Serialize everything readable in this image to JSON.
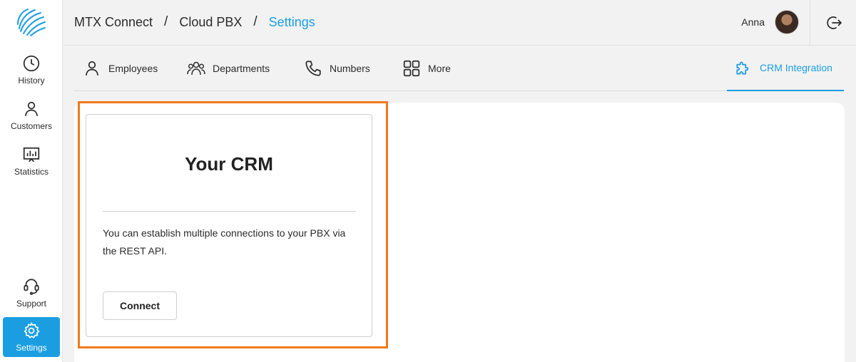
{
  "sidebar": {
    "items": [
      {
        "label": "History",
        "icon": "clock-icon"
      },
      {
        "label": "Customers",
        "icon": "person-icon"
      },
      {
        "label": "Statistics",
        "icon": "chart-icon"
      },
      {
        "label": "Support",
        "icon": "headset-icon"
      },
      {
        "label": "Settings",
        "icon": "gear-icon"
      }
    ]
  },
  "header": {
    "breadcrumb": [
      "MTX Connect",
      "Cloud PBX",
      "Settings"
    ],
    "separator": "/",
    "user_name": "Anna"
  },
  "tabs": [
    {
      "label": "Employees",
      "icon": "person-icon"
    },
    {
      "label": "Departments",
      "icon": "people-icon"
    },
    {
      "label": "Numbers",
      "icon": "phone-icon"
    },
    {
      "label": "More",
      "icon": "grid-icon"
    },
    {
      "label": "CRM Integration",
      "icon": "puzzle-icon"
    }
  ],
  "card": {
    "title": "Your CRM",
    "description": "You can establish multiple connections to your PBX via the REST API.",
    "button_label": "Connect"
  },
  "colors": {
    "accent": "#1a9ee1",
    "highlight": "#f07a1a"
  }
}
